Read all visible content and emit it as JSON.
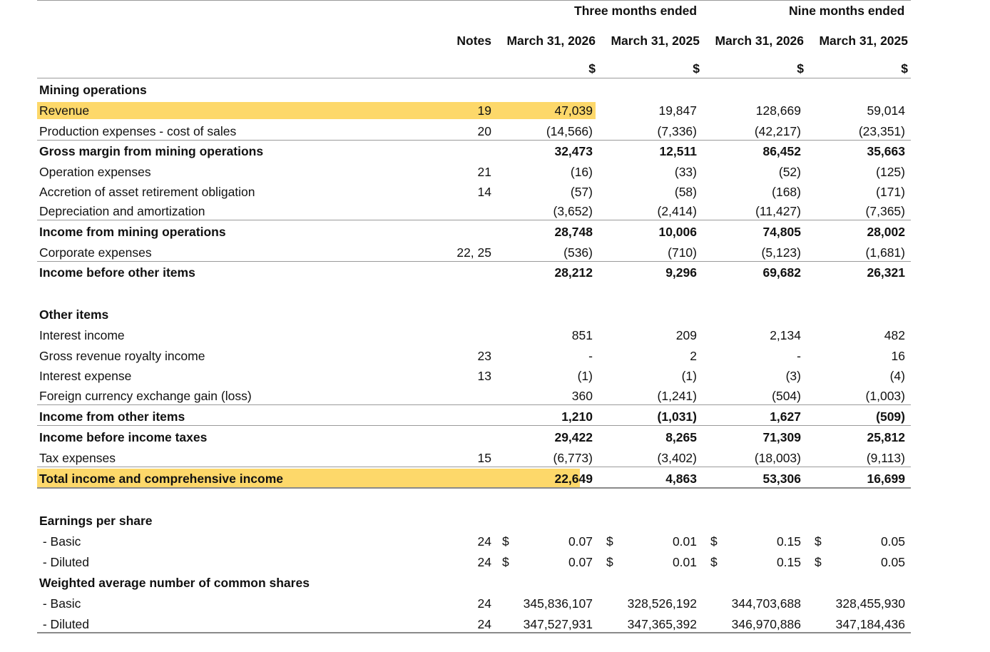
{
  "header": {
    "three_months": "Three months ended",
    "nine_months": "Nine months ended",
    "notes": "Notes",
    "columns": [
      "March 31, 2026",
      "March 31, 2025",
      "March 31, 2026",
      "March 31, 2025"
    ],
    "currency": "$"
  },
  "highlight_color": "#fdd86a",
  "rows": [
    {
      "label": "Mining operations",
      "bold": true,
      "note": "",
      "values": [
        "",
        "",
        "",
        ""
      ]
    },
    {
      "label": "Revenue",
      "note": "19",
      "values": [
        "47,039",
        "19,847",
        "128,669",
        "59,014"
      ]
    },
    {
      "label": "Production expenses - cost of sales",
      "note": "20",
      "values": [
        "(14,566)",
        "(7,336)",
        "(42,217)",
        "(23,351)"
      ]
    },
    {
      "label": "Gross margin from mining operations",
      "bold": true,
      "note": "",
      "values": [
        "32,473",
        "12,511",
        "86,452",
        "35,663"
      ]
    },
    {
      "label": "Operation expenses",
      "note": "21",
      "values": [
        "(16)",
        "(33)",
        "(52)",
        "(125)"
      ]
    },
    {
      "label": "Accretion of asset retirement obligation",
      "note": "14",
      "values": [
        "(57)",
        "(58)",
        "(168)",
        "(171)"
      ]
    },
    {
      "label": "Depreciation and amortization",
      "note": "",
      "values": [
        "(3,652)",
        "(2,414)",
        "(11,427)",
        "(7,365)"
      ]
    },
    {
      "label": "Income from mining operations",
      "bold": true,
      "note": "",
      "values": [
        "28,748",
        "10,006",
        "74,805",
        "28,002"
      ]
    },
    {
      "label": "Corporate expenses",
      "note": "22, 25",
      "values": [
        "(536)",
        "(710)",
        "(5,123)",
        "(1,681)"
      ]
    },
    {
      "label": "Income before other items",
      "bold": true,
      "note": "",
      "values": [
        "28,212",
        "9,296",
        "69,682",
        "26,321"
      ]
    },
    {
      "label": "Other items",
      "bold": true,
      "note": "",
      "values": [
        "",
        "",
        "",
        ""
      ]
    },
    {
      "label": "Interest income",
      "note": "",
      "values": [
        "851",
        "209",
        "2,134",
        "482"
      ]
    },
    {
      "label": "Gross revenue royalty income",
      "note": "23",
      "values": [
        "-",
        "2",
        "-",
        "16"
      ]
    },
    {
      "label": "Interest expense",
      "note": "13",
      "values": [
        "(1)",
        "(1)",
        "(3)",
        "(4)"
      ]
    },
    {
      "label": "Foreign currency exchange gain (loss)",
      "note": "",
      "values": [
        "360",
        "(1,241)",
        "(504)",
        "(1,003)"
      ]
    },
    {
      "label": "Income from other items",
      "bold": true,
      "note": "",
      "values": [
        "1,210",
        "(1,031)",
        "1,627",
        "(509)"
      ]
    },
    {
      "label": "Income before income taxes",
      "bold": true,
      "note": "",
      "values": [
        "29,422",
        "8,265",
        "71,309",
        "25,812"
      ]
    },
    {
      "label": "Tax expenses",
      "note": "15",
      "values": [
        "(6,773)",
        "(3,402)",
        "(18,003)",
        "(9,113)"
      ]
    },
    {
      "label": "Total income and comprehensive income",
      "bold": true,
      "note": "",
      "values": [
        "22,649",
        "4,863",
        "53,306",
        "16,699"
      ]
    },
    {
      "label": "Earnings per share",
      "bold": true,
      "note": "",
      "values": [
        "",
        "",
        "",
        ""
      ]
    },
    {
      "label": " - Basic",
      "note": "24",
      "values": [
        "0.07",
        "0.01",
        "0.15",
        "0.05"
      ],
      "dollar": true
    },
    {
      "label": " - Diluted",
      "note": "24",
      "values": [
        "0.07",
        "0.01",
        "0.15",
        "0.05"
      ],
      "dollar": true
    },
    {
      "label": "Weighted average number of common shares",
      "bold": true,
      "note": "",
      "values": [
        "",
        "",
        "",
        ""
      ]
    },
    {
      "label": " - Basic",
      "note": "24",
      "values": [
        "345,836,107",
        "328,526,192",
        "344,703,688",
        "328,455,930"
      ]
    },
    {
      "label": " - Diluted",
      "note": "24",
      "values": [
        "347,527,931",
        "347,365,392",
        "346,970,886",
        "347,184,436"
      ]
    }
  ]
}
